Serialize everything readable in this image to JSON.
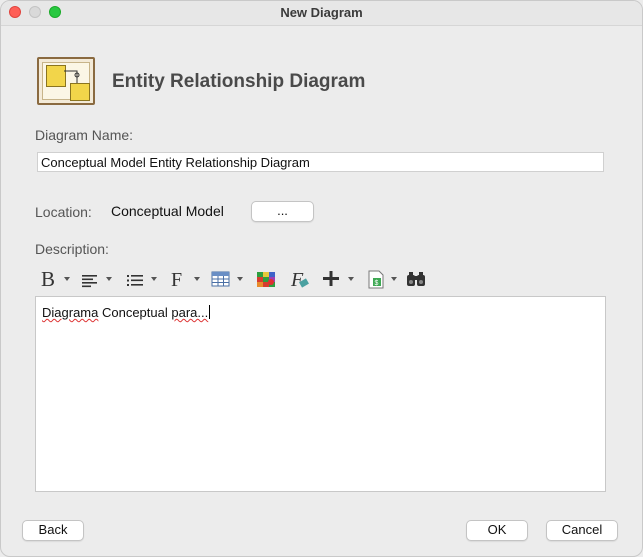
{
  "window": {
    "title": "New Diagram"
  },
  "header": {
    "title": "Entity Relationship Diagram",
    "icon": "er-diagram-icon"
  },
  "name_field": {
    "label": "Diagram Name:",
    "value": "Conceptual Model Entity Relationship Diagram"
  },
  "location": {
    "label": "Location:",
    "value": "Conceptual Model",
    "browse_label": "..."
  },
  "description": {
    "label": "Description:",
    "text_part1": "Diagrama",
    "text_part2": " Conceptual ",
    "text_part3": "para...",
    "toolbar": [
      "bold-icon",
      "align-icon",
      "list-icon",
      "font-icon",
      "table-icon",
      "color-icon",
      "clear-format-icon",
      "insert-icon",
      "file-icon",
      "find-icon"
    ]
  },
  "buttons": {
    "back": "Back",
    "ok": "OK",
    "cancel": "Cancel"
  }
}
